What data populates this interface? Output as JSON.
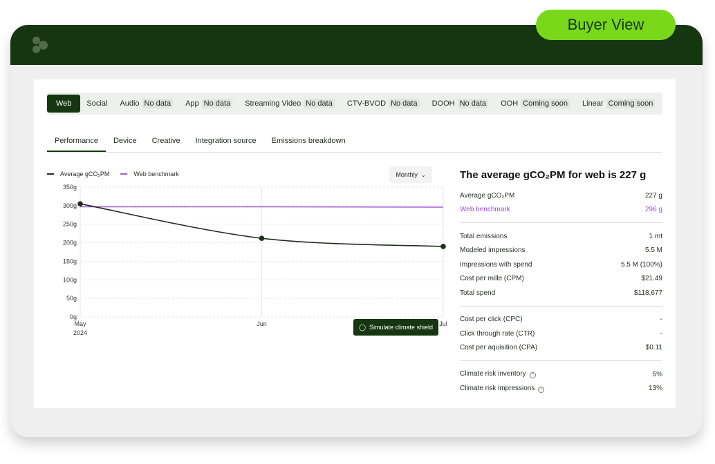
{
  "buyer_view_label": "Buyer View",
  "channels": [
    {
      "label": "Web",
      "tag": "",
      "active": true
    },
    {
      "label": "Social",
      "tag": ""
    },
    {
      "label": "Audio",
      "tag": "No data"
    },
    {
      "label": "App",
      "tag": "No data"
    },
    {
      "label": "Streaming Video",
      "tag": "No data"
    },
    {
      "label": "CTV-BVOD",
      "tag": "No data"
    },
    {
      "label": "DOOH",
      "tag": "No data"
    },
    {
      "label": "OOH",
      "tag": "Coming soon"
    },
    {
      "label": "Linear",
      "tag": "Coming soon"
    }
  ],
  "subtabs": [
    "Performance",
    "Device",
    "Creative",
    "Integration source",
    "Emissions breakdown"
  ],
  "legend": {
    "series1": "Average gCO₂PM",
    "series2": "Web benchmark"
  },
  "period_select": "Monthly",
  "simulate_button": "Simulate climate shield",
  "colors": {
    "series1": "#1f2d1c",
    "series2": "#a05cd6",
    "brand": "#163511",
    "accent": "#7ad81a"
  },
  "chart_data": {
    "type": "line",
    "x": [
      "May\n2024",
      "Jun",
      "Jul"
    ],
    "x_ticks": [
      "May",
      "Jun",
      "Jul"
    ],
    "x_sub": "2024",
    "y_ticks": [
      "350g",
      "300g",
      "250g",
      "200g",
      "150g",
      "100g",
      "50g",
      "0g"
    ],
    "ylim": [
      0,
      350
    ],
    "series": [
      {
        "name": "Average gCO₂PM",
        "values": [
          305,
          212,
          190
        ]
      },
      {
        "name": "Web benchmark",
        "values": [
          297,
          297,
          296
        ]
      }
    ],
    "grid": true
  },
  "stats": {
    "title": "The average gCO₂PM for web is 227 g",
    "avg_label": "Average gCO₂PM",
    "avg_value": "227 g",
    "bench_label": "Web benchmark",
    "bench_value": "296 g",
    "group1": [
      {
        "label": "Total emissions",
        "value": "1 mt"
      },
      {
        "label": "Modeled impressions",
        "value": "5.5 M"
      },
      {
        "label": "Impressions with spend",
        "value": "5.5 M (100%)"
      },
      {
        "label": "Cost per mille (CPM)",
        "value": "$21.49"
      },
      {
        "label": "Total spend",
        "value": "$118,677"
      }
    ],
    "group2": [
      {
        "label": "Cost per click (CPC)",
        "value": "-"
      },
      {
        "label": "Click through rate (CTR)",
        "value": "-"
      },
      {
        "label": "Cost per aquisition (CPA)",
        "value": "$0.11"
      }
    ],
    "group3": [
      {
        "label": "Climate risk inventory",
        "value": "5%"
      },
      {
        "label": "Climate risk impressions",
        "value": "13%"
      }
    ]
  }
}
